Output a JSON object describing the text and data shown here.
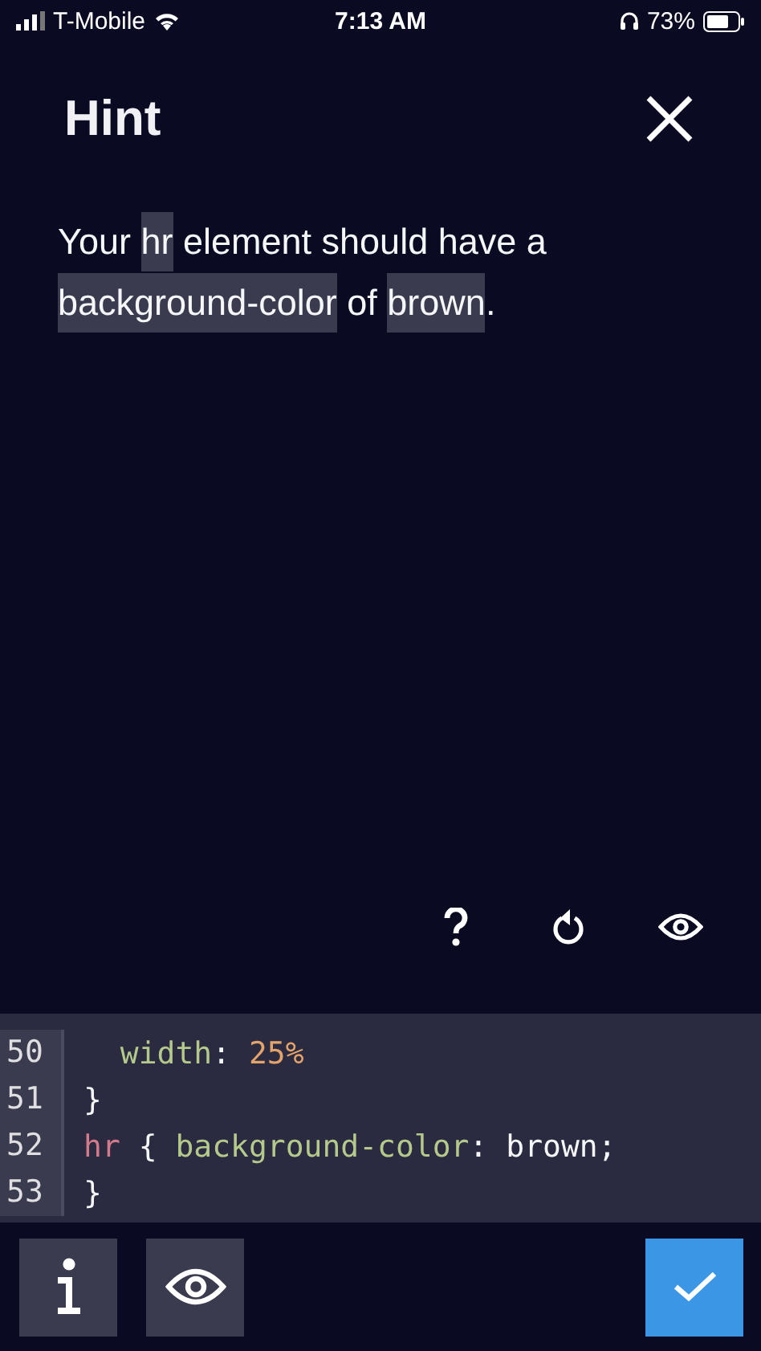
{
  "status_bar": {
    "carrier": "T-Mobile",
    "time": "7:13 AM",
    "battery": "73%"
  },
  "hint": {
    "title": "Hint",
    "text": [
      {
        "text": "Your ",
        "code": false
      },
      {
        "text": "hr",
        "code": true
      },
      {
        "text": " element should have a ",
        "code": false
      },
      {
        "text": "background-color",
        "code": true
      },
      {
        "text": " of ",
        "code": false
      },
      {
        "text": "brown",
        "code": true
      },
      {
        "text": ".",
        "code": false
      }
    ]
  },
  "hint_actions": [
    {
      "kind": "help"
    },
    {
      "kind": "reset"
    },
    {
      "kind": "preview"
    }
  ],
  "editor": {
    "lines": [
      {
        "number": "50",
        "tokens": [
          {
            "text": "  width",
            "kind": "property"
          },
          {
            "text": ": ",
            "kind": "plain"
          },
          {
            "text": "25%",
            "kind": "number"
          }
        ]
      },
      {
        "number": "51",
        "tokens": [
          {
            "text": "}",
            "kind": "plain"
          }
        ]
      },
      {
        "number": "52",
        "tokens": [
          {
            "text": "hr",
            "kind": "selector"
          },
          {
            "text": " { ",
            "kind": "plain"
          },
          {
            "text": "background-color",
            "kind": "property"
          },
          {
            "text": ": brown;",
            "kind": "plain"
          }
        ]
      },
      {
        "number": "53",
        "tokens": [
          {
            "text": "}",
            "kind": "plain"
          }
        ]
      }
    ]
  },
  "toolbar": [
    {
      "kind": "info"
    },
    {
      "kind": "preview"
    },
    {
      "kind": "spacer"
    },
    {
      "kind": "check"
    }
  ]
}
